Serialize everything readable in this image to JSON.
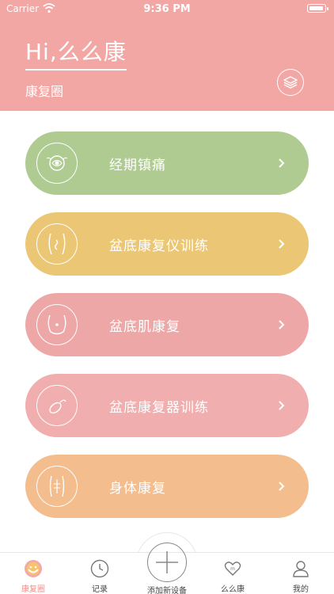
{
  "status": {
    "carrier": "Carrier",
    "time": "9:36 PM"
  },
  "header": {
    "greeting": "Hi,么么康",
    "subtitle": "康复圈",
    "bg": "#f2a7a5"
  },
  "menu": [
    {
      "label": "经期镇痛",
      "color": "#afcb92",
      "icon": "uterus-icon"
    },
    {
      "label": "盆底康复仪训练",
      "color": "#ebc775",
      "icon": "abdomen-icon"
    },
    {
      "label": "盆底肌康复",
      "color": "#eda7a7",
      "icon": "pelvis-icon"
    },
    {
      "label": "盆底康复器训练",
      "color": "#f1aeae",
      "icon": "device-icon"
    },
    {
      "label": "身体康复",
      "color": "#f3bd8e",
      "icon": "torso-icon"
    }
  ],
  "tabbar": {
    "tabs": [
      {
        "label": "康复圈",
        "active": true
      },
      {
        "label": "记录"
      },
      {
        "label": "添加新设备"
      },
      {
        "label": "么么康"
      },
      {
        "label": "我的"
      }
    ],
    "accent": "#f08f8c"
  }
}
